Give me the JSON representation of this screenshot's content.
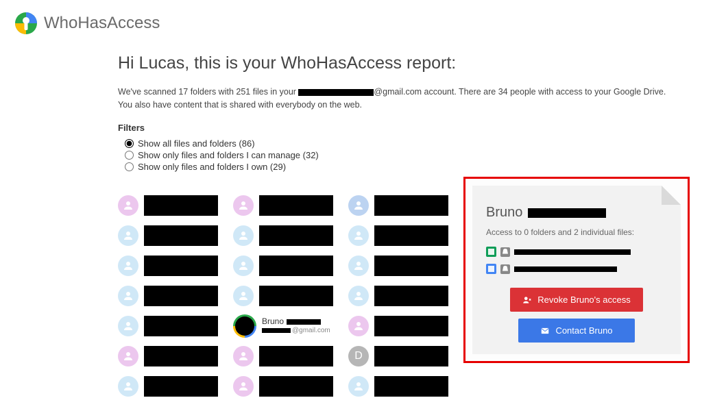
{
  "app_name": "WhoHasAccess",
  "heading": "Hi Lucas, this is your WhoHasAccess report:",
  "scan_line_prefix": "We've scanned 17 folders with 251 files in your ",
  "scan_email_suffix": "@gmail.com",
  "scan_line_suffix": " account. There are 34 people with access to your Google Drive.",
  "scan_line2": "You also have content that is shared with everybody on the web.",
  "filters_title": "Filters",
  "filters": {
    "0": {
      "label": "Show all files and folders (86)"
    },
    "1": {
      "label": "Show only files and folders I can manage (32)"
    },
    "2": {
      "label": "Show only files and folders I own (29)"
    }
  },
  "bruno": {
    "name": "Bruno",
    "email_suffix": "@gmail.com"
  },
  "letter_avatar": "D",
  "panel": {
    "name": "Bruno",
    "subtitle": "Access to 0 folders and 2 individual files:",
    "revoke": "Revoke Bruno's access",
    "contact": "Contact Bruno"
  }
}
